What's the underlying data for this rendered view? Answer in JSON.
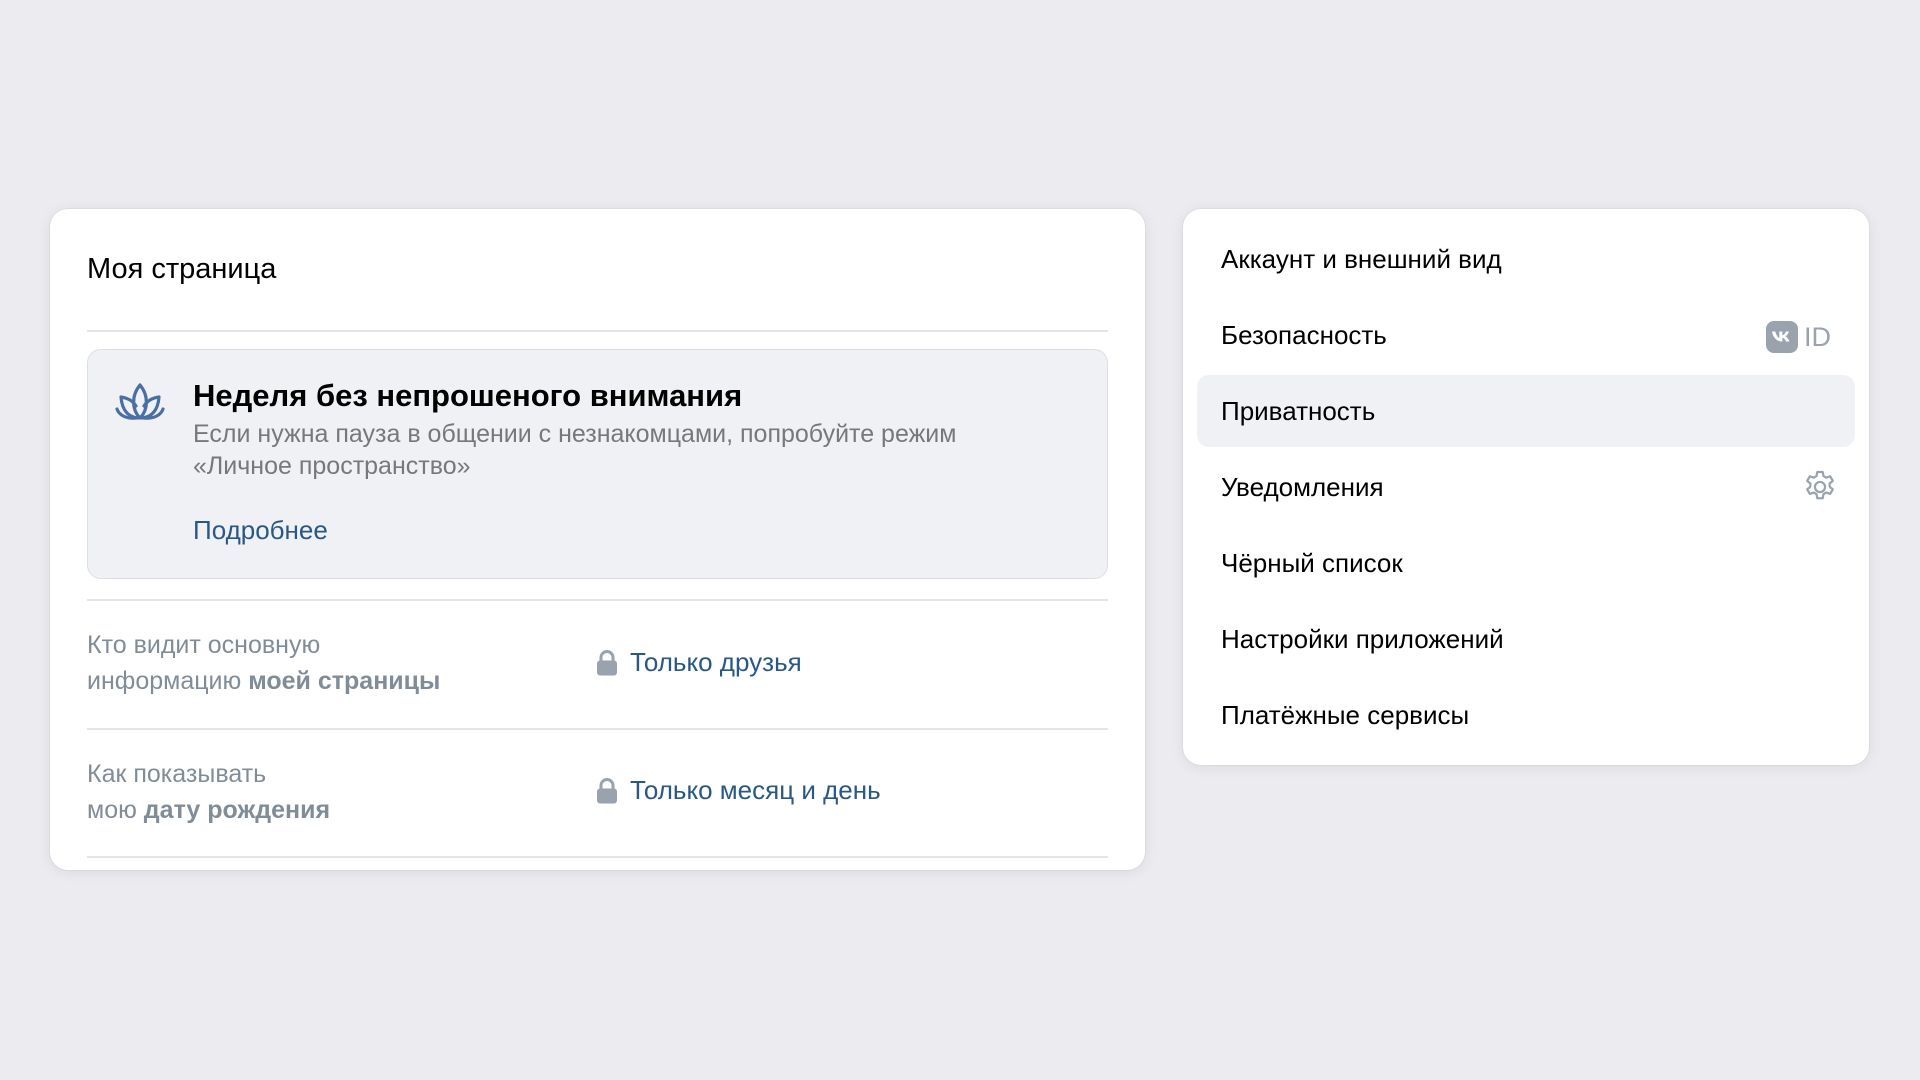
{
  "my_page": {
    "title": "Моя страница",
    "promo": {
      "icon": "lotus-icon",
      "title": "Неделя без непрошеного внимания",
      "text": "Если нужна пауза в общении с незнакомцами, попробуйте режим «Личное пространство»",
      "link": "Подробнее"
    },
    "settings": [
      {
        "label_line1": "Кто видит основную",
        "label_line2_prefix": "информацию ",
        "label_line2_bold": "моей страницы",
        "value": "Только друзья",
        "icon": "lock-icon"
      },
      {
        "label_line1": "Как показывать",
        "label_line2_prefix": "мою ",
        "label_line2_bold": "дату рождения",
        "value": "Только месяц и день",
        "icon": "lock-icon"
      }
    ]
  },
  "menu": {
    "items": [
      {
        "label": "Аккаунт и внешний вид"
      },
      {
        "label": "Безопасность",
        "badge": "ID",
        "badge_icon": "vk-logo-icon"
      },
      {
        "label": "Приватность",
        "active": true
      },
      {
        "label": "Уведомления",
        "icon": "gear-icon"
      },
      {
        "label": "Чёрный список"
      },
      {
        "label": "Настройки приложений"
      },
      {
        "label": "Платёжные сервисы"
      }
    ]
  },
  "colors": {
    "background": "#ebebf0",
    "card": "#ffffff",
    "link": "#2a5885",
    "muted_text": "#818c99",
    "promo_bg": "#f0f1f5",
    "accent_icon": "#4a6fa5",
    "badge_grey": "#99a2ad"
  }
}
